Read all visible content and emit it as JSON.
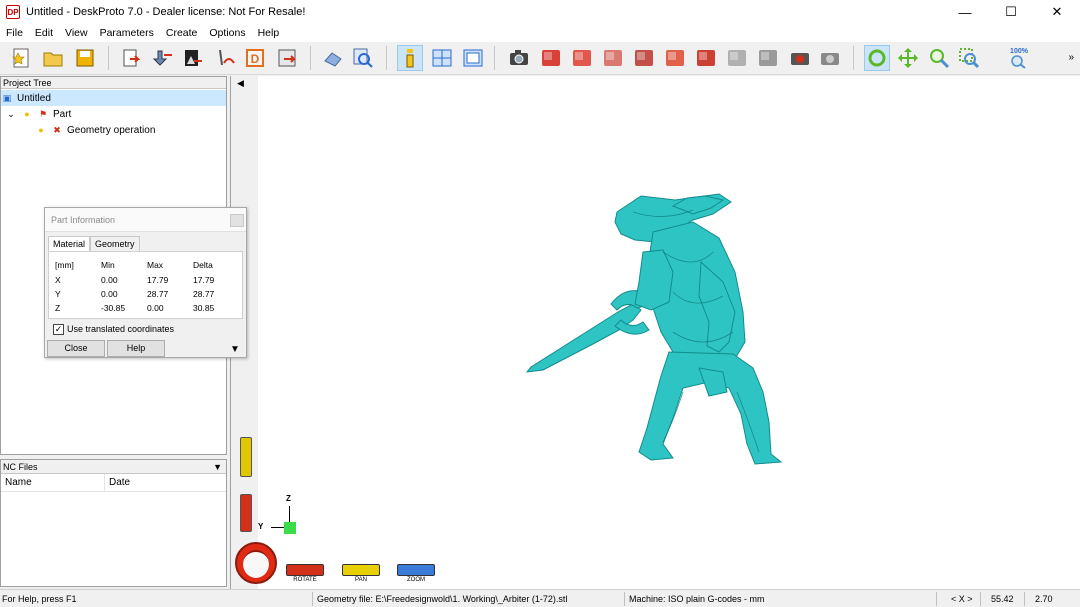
{
  "window": {
    "app_icon_text": "DP",
    "title": "Untitled - DeskProto 7.0 - Dealer license: Not For Resale!",
    "minimize": "—",
    "maximize": "☐",
    "close": "✕"
  },
  "menu": [
    "File",
    "Edit",
    "View",
    "Parameters",
    "Create",
    "Options",
    "Help"
  ],
  "toolbar": {
    "zoom_100_label": "100%",
    "more": "»",
    "colors": {
      "view_cube_red": "#d8403a",
      "view_cube_gray": "#9a9a9a",
      "green_tool": "#5ab82a",
      "blue_tool": "#4a8fd6"
    }
  },
  "project_tree": {
    "header": "Project Tree",
    "root": "Untitled",
    "part": "Part",
    "geometry_operation": "Geometry operation"
  },
  "nc_files": {
    "header": "NC Files",
    "columns": [
      "Name",
      "Date"
    ]
  },
  "part_information": {
    "title": "Part Information",
    "tabs": [
      "Material",
      "Geometry"
    ],
    "header": [
      "[mm]",
      "Min",
      "Max",
      "Delta"
    ],
    "rows": [
      [
        "X",
        "0.00",
        "17.79",
        "17.79"
      ],
      [
        "Y",
        "0.00",
        "28.77",
        "28.77"
      ],
      [
        "Z",
        "-30.85",
        "0.00",
        "30.85"
      ]
    ],
    "checkbox_label": "Use translated coordinates",
    "checkbox_checked": true,
    "close_button": "Close",
    "help_button": "Help"
  },
  "viewport": {
    "controls": [
      "ROTATE",
      "PAN",
      "ZOOM"
    ],
    "axis_z": "Z",
    "axis_y": "Y",
    "model_color": "#2ec4c4"
  },
  "status": {
    "help": "For Help, press F1",
    "geometry_file": "Geometry file: E:\\Freedesignwold\\1. Working\\_Arbiter (1-72).stl",
    "machine": "Machine: ISO plain G-codes - mm",
    "axis": "< X >",
    "value1": "55.42",
    "value2": "2.70"
  }
}
